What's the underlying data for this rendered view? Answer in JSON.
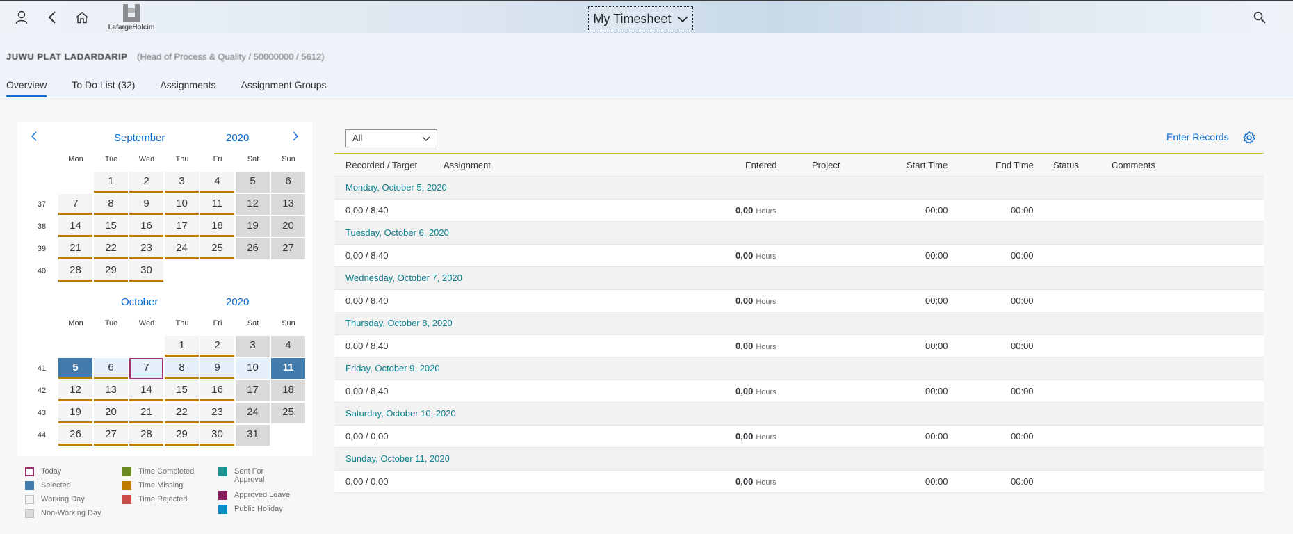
{
  "shell": {
    "logo_text": "LafargeHolcim",
    "app_title": "My Timesheet"
  },
  "header": {
    "employee_name": "JUWU PLAT LADARDARIP",
    "employee_detail": "(Head of Process & Quality / 50000000 / 5612)",
    "tabs": [
      "Overview",
      "To Do List (32)",
      "Assignments",
      "Assignment Groups"
    ],
    "active_tab": "Overview"
  },
  "calendar": {
    "weekdays": [
      "Mon",
      "Tue",
      "Wed",
      "Thu",
      "Fri",
      "Sat",
      "Sun"
    ],
    "months": [
      {
        "month": "September",
        "year": "2020",
        "weeks": [
          {
            "week": "",
            "days": [
              "",
              "1",
              "2",
              "3",
              "4",
              "5",
              "6"
            ]
          },
          {
            "week": "37",
            "days": [
              "7",
              "8",
              "9",
              "10",
              "11",
              "12",
              "13"
            ]
          },
          {
            "week": "38",
            "days": [
              "14",
              "15",
              "16",
              "17",
              "18",
              "19",
              "20"
            ]
          },
          {
            "week": "39",
            "days": [
              "21",
              "22",
              "23",
              "24",
              "25",
              "26",
              "27"
            ]
          },
          {
            "week": "40",
            "days": [
              "28",
              "29",
              "30",
              "",
              "",
              "",
              ""
            ]
          }
        ]
      },
      {
        "month": "October",
        "year": "2020",
        "weeks": [
          {
            "week": "",
            "days": [
              "",
              "",
              "",
              "1",
              "2",
              "3",
              "4"
            ]
          },
          {
            "week": "41",
            "days": [
              "5",
              "6",
              "7",
              "8",
              "9",
              "10",
              "11"
            ]
          },
          {
            "week": "42",
            "days": [
              "12",
              "13",
              "14",
              "15",
              "16",
              "17",
              "18"
            ]
          },
          {
            "week": "43",
            "days": [
              "19",
              "20",
              "21",
              "22",
              "23",
              "24",
              "25"
            ]
          },
          {
            "week": "44",
            "days": [
              "26",
              "27",
              "28",
              "29",
              "30",
              "31",
              ""
            ]
          }
        ]
      }
    ],
    "today": "October 7",
    "selected_range": "October 5 - October 11",
    "legend": [
      {
        "label": "Today",
        "color": "#a0306b",
        "style": "outline"
      },
      {
        "label": "Selected",
        "color": "#427cac",
        "style": "fill"
      },
      {
        "label": "Working Day",
        "color": "#f4f4f4",
        "style": "fill"
      },
      {
        "label": "Non-Working Day",
        "color": "#d9d9d9",
        "style": "fill"
      },
      {
        "label": "Time Completed",
        "color": "#6a8b21",
        "style": "fill"
      },
      {
        "label": "Time Missing",
        "color": "#bf7a00",
        "style": "fill"
      },
      {
        "label": "Time Rejected",
        "color": "#cc4a4a",
        "style": "fill"
      },
      {
        "label": "Sent For Approval",
        "color": "#1e9493",
        "style": "fill"
      },
      {
        "label": "Approved Leave",
        "color": "#8b1f5f",
        "style": "fill"
      },
      {
        "label": "Public Holiday",
        "color": "#0a8dc8",
        "style": "fill"
      }
    ]
  },
  "toolbar": {
    "filter_value": "All",
    "enter_records_label": "Enter Records"
  },
  "table": {
    "columns": [
      "Recorded / Target",
      "Assignment",
      "Entered",
      "Project",
      "Start Time",
      "End Time",
      "Status",
      "Comments"
    ],
    "hours_unit": "Hours",
    "groups": [
      {
        "date": "Monday, October 5, 2020",
        "recorded_target": "0,00 / 8,40",
        "entered": "0,00",
        "start": "00:00",
        "end": "00:00"
      },
      {
        "date": "Tuesday, October 6, 2020",
        "recorded_target": "0,00 / 8,40",
        "entered": "0,00",
        "start": "00:00",
        "end": "00:00"
      },
      {
        "date": "Wednesday, October 7, 2020",
        "recorded_target": "0,00 / 8,40",
        "entered": "0,00",
        "start": "00:00",
        "end": "00:00"
      },
      {
        "date": "Thursday, October 8, 2020",
        "recorded_target": "0,00 / 8,40",
        "entered": "0,00",
        "start": "00:00",
        "end": "00:00"
      },
      {
        "date": "Friday, October 9, 2020",
        "recorded_target": "0,00 / 8,40",
        "entered": "0,00",
        "start": "00:00",
        "end": "00:00"
      },
      {
        "date": "Saturday, October 10, 2020",
        "recorded_target": "0,00 / 0,00",
        "entered": "0,00",
        "start": "00:00",
        "end": "00:00"
      },
      {
        "date": "Sunday, October 11, 2020",
        "recorded_target": "0,00 / 0,00",
        "entered": "0,00",
        "start": "00:00",
        "end": "00:00"
      }
    ]
  },
  "colors": {
    "accent": "#0a6ed1",
    "group_date": "#0a7f8e",
    "time_missing": "#bf7a00",
    "selected": "#427cac",
    "today": "#a0306b"
  }
}
